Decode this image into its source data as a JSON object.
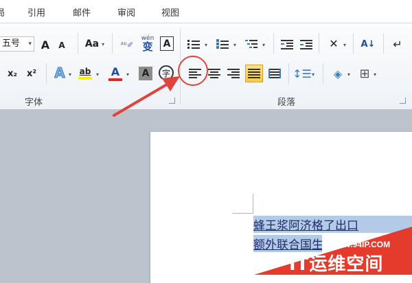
{
  "ribbon_tabs": [
    "局",
    "引用",
    "邮件",
    "审阅",
    "视图"
  ],
  "font_group": {
    "label": "字体",
    "font_size_value": "五号",
    "grow_font": "A",
    "shrink_font": "A",
    "change_case": "Aa",
    "phonetic_guide": "wén",
    "phonetic_char": "变",
    "char_border": "A",
    "subscript": "x₂",
    "superscript": "x²",
    "text_effects": "A",
    "highlight": "ab",
    "font_color": "A",
    "char_shading": "A",
    "enclose_char": "字"
  },
  "paragraph_group": {
    "label": "段落",
    "sort": "A↓",
    "active_alignment": "justify"
  },
  "document": {
    "line1": "蜂王浆阿济格了出口",
    "line2": "额外联合国生"
  },
  "watermark": {
    "url": "WWW.94IP.COM",
    "name": "IT运维空间"
  },
  "colors": {
    "highlight_yellow": "#ffee00",
    "font_red": "#e0271f",
    "selection": "#b3cbe7",
    "annotation_red": "#e0433b",
    "active_button": "#ffca3a"
  }
}
